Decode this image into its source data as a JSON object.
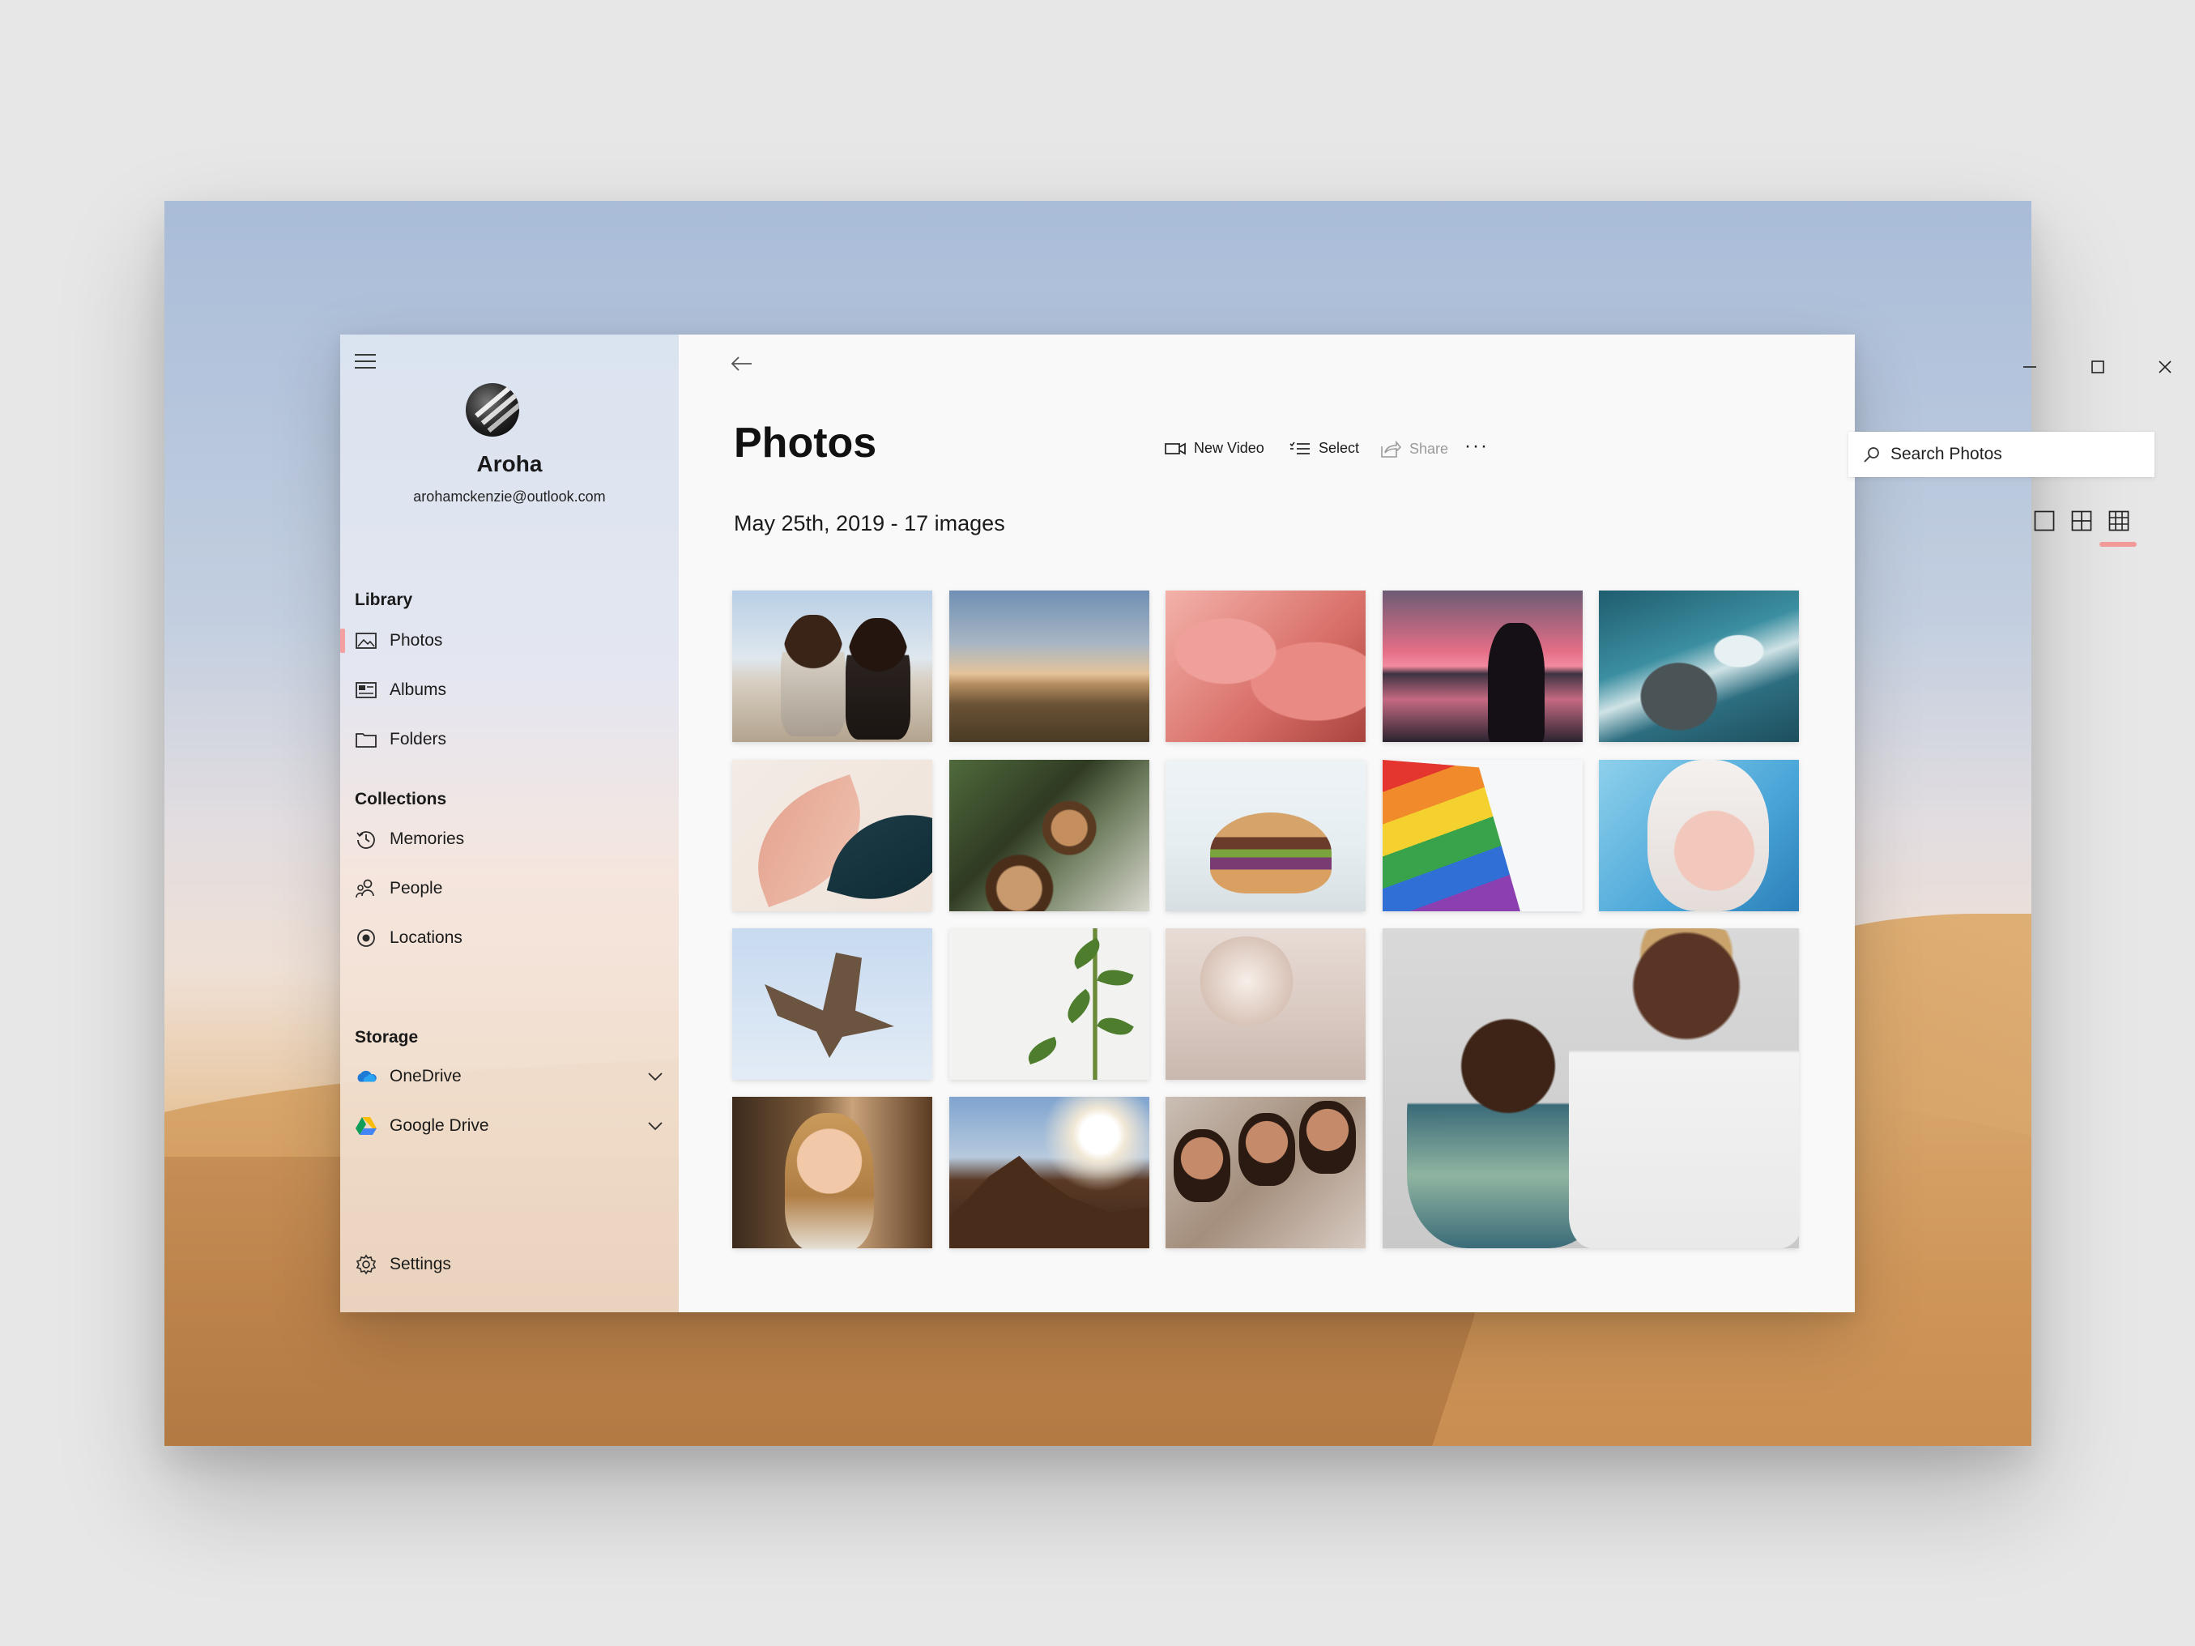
{
  "sidebar": {
    "user": {
      "name": "Aroha",
      "email": "arohamckenzie@outlook.com"
    },
    "library_heading": "Library",
    "library_items": [
      {
        "label": "Photos",
        "icon": "photo-icon",
        "active": true
      },
      {
        "label": "Albums",
        "icon": "albums-icon"
      },
      {
        "label": "Folders",
        "icon": "folder-icon"
      }
    ],
    "collections_heading": "Collections",
    "collection_items": [
      {
        "label": "Memories",
        "icon": "history-icon"
      },
      {
        "label": "People",
        "icon": "people-icon"
      },
      {
        "label": "Locations",
        "icon": "location-icon"
      }
    ],
    "storage_heading": "Storage",
    "storage_items": [
      {
        "label": "OneDrive",
        "icon": "onedrive-icon"
      },
      {
        "label": "Google Drive",
        "icon": "google-drive-icon"
      }
    ],
    "settings_label": "Settings"
  },
  "main": {
    "title": "Photos",
    "toolbar": {
      "new_video": "New Video",
      "select": "Select",
      "share": "Share",
      "more": "···"
    },
    "search": {
      "placeholder": "Search Photos"
    },
    "date_line": "May 25th, 2019 - 17 images",
    "view_modes": [
      "single-view-icon",
      "medium-grid-icon",
      "small-grid-icon"
    ],
    "active_view": "small-grid-icon",
    "image_count": 17
  },
  "colors": {
    "accent": "#f29a9a",
    "main_bg": "#f9f9f9"
  }
}
